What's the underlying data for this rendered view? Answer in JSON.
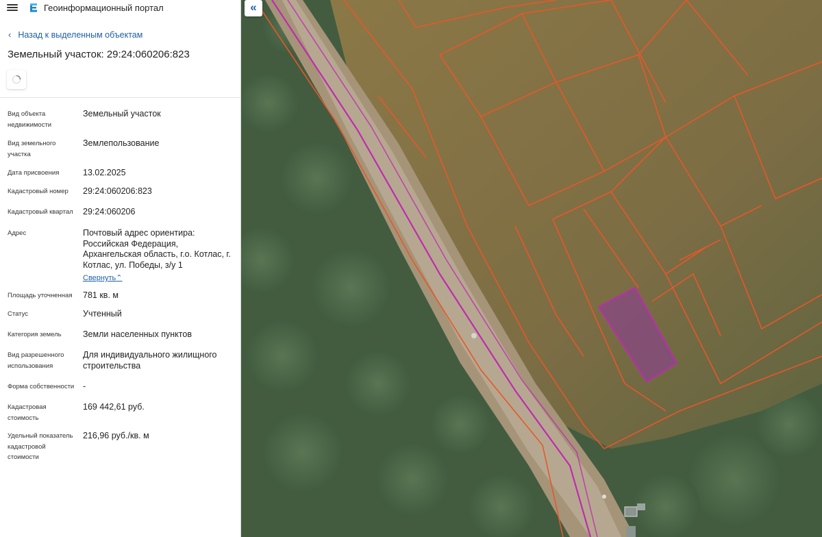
{
  "header": {
    "menu_icon": "hamburger-menu-icon",
    "logo_icon": "portal-logo-icon",
    "app_title": "Геоинформационный портал"
  },
  "nav": {
    "back_label": "Назад к выделенным объектам",
    "collapse_icon": "double-chevron-left-icon"
  },
  "object": {
    "title": "Земельный участок: 29:24:060206:823"
  },
  "properties": [
    {
      "label": "Вид объекта недвижимости",
      "value": "Земельный участок"
    },
    {
      "label": "Вид земельного участка",
      "value": "Землепользование"
    },
    {
      "label": "Дата присвоения",
      "value": "13.02.2025"
    },
    {
      "label": "Кадастровый номер",
      "value": "29:24:060206:823"
    },
    {
      "label": "Кадастровый квартал",
      "value": "29:24:060206"
    },
    {
      "label": "Адрес",
      "value": "Почтовый адрес ориентира: Российская Федерация, Архангельская область, г.о. Котлас, г. Котлас, ул. Победы, з/у 1",
      "toggle": "Свернуть"
    },
    {
      "label": "Площадь уточненная",
      "value": "781 кв. м"
    },
    {
      "label": "Статус",
      "value": "Учтенный"
    },
    {
      "label": "Категория земель",
      "value": "Земли населенных пунктов"
    },
    {
      "label": "Вид разрешенного использования",
      "value": "Для индивидуального жилищного строительства"
    },
    {
      "label": "Форма собственности",
      "value": "-"
    },
    {
      "label": "Кадастровая стоимость",
      "value": "169 442,61 руб."
    },
    {
      "label": "Удельный показатель кадастровой стоимости",
      "value": "216,96 руб./кв. м"
    }
  ],
  "colors": {
    "accent": "#1f5fa8",
    "parcel_boundary": "#e8572a",
    "selected_parcel": "#b03aa8",
    "road_line": "#c02ab0"
  }
}
